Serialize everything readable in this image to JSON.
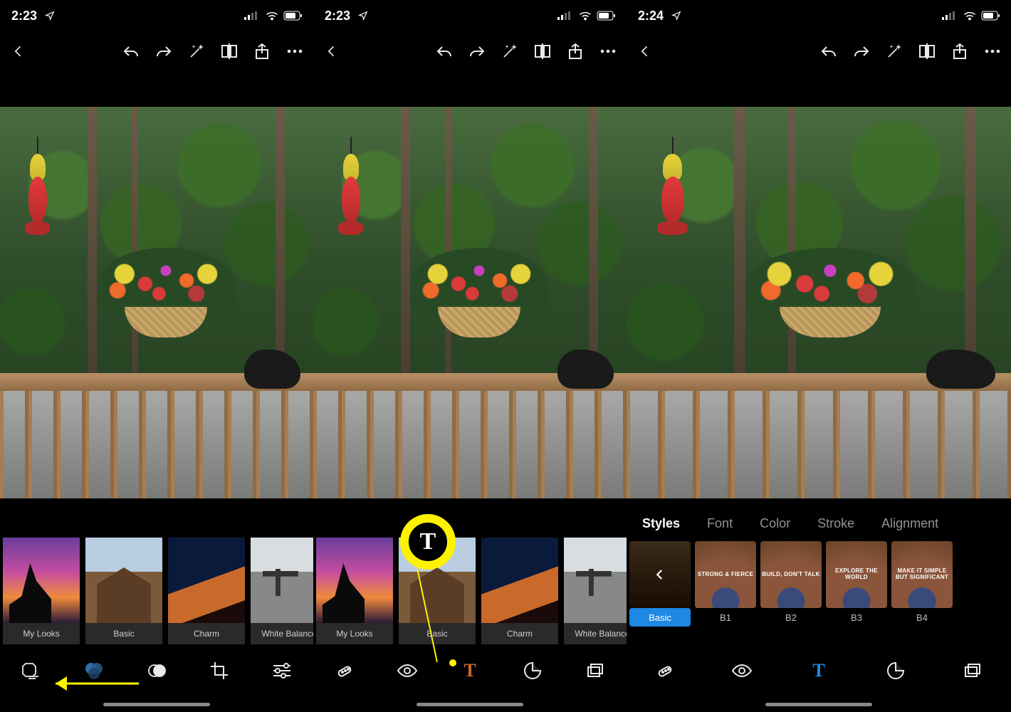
{
  "screens": [
    {
      "status_time": "2:23",
      "looks": [
        "My Looks",
        "Basic",
        "Charm",
        "White Balance"
      ]
    },
    {
      "status_time": "2:23",
      "looks": [
        "My Looks",
        "Basic",
        "Charm",
        "White Balance"
      ]
    },
    {
      "status_time": "2:24",
      "text_tabs": [
        "Styles",
        "Font",
        "Color",
        "Stroke",
        "Alignment"
      ],
      "text_tab_active": 0,
      "style_cards": [
        "Basic",
        "B1",
        "B2",
        "B3",
        "B4"
      ],
      "style_card_text": [
        "",
        "STRONG & FIERCE",
        "BUILD, DON'T TALK",
        "EXPLORE THE WORLD",
        "MAKE IT SIMPLE BUT SIGNIFICANT"
      ],
      "style_active": 0
    }
  ],
  "top_icons": [
    "back",
    "undo",
    "redo",
    "auto-enhance",
    "compare",
    "share",
    "more"
  ],
  "nav_icons_s1": [
    "shape-tool",
    "looks-tool",
    "overlap-tool",
    "crop-tool",
    "sliders-tool"
  ],
  "nav_icons_s2": [
    "heal-tool",
    "eye-tool",
    "text-tool",
    "sticker-tool",
    "layers-tool"
  ],
  "nav_icons_s3": [
    "heal-tool",
    "eye-tool",
    "text-tool",
    "sticker-tool",
    "layers-tool"
  ],
  "annotation": {
    "circle_letter": "T",
    "highlight_color": "#fff200"
  }
}
